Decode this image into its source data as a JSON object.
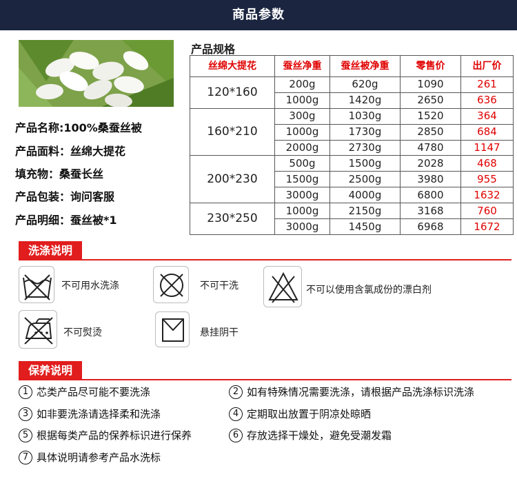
{
  "header": {
    "title": "商品参数"
  },
  "product": {
    "name": "产品名称:100%桑蚕丝被",
    "fabric": "产品面料：丝绵大提花",
    "filling": "填充物：桑蚕长丝",
    "packaging": "产品包装：询问客服",
    "details": "产品明细：蚕丝被*1"
  },
  "spec": {
    "title": "产品规格",
    "headers": [
      "丝绵大提花",
      "蚕丝净重",
      "蚕丝被净重",
      "零售价",
      "出厂价"
    ],
    "sizes": [
      "120*160",
      "160*210",
      "200*230",
      "230*250"
    ],
    "rows": [
      [
        "200g",
        "620g",
        "1090",
        "261"
      ],
      [
        "1000g",
        "1420g",
        "2650",
        "636"
      ],
      [
        "300g",
        "1030g",
        "1520",
        "364"
      ],
      [
        "1000g",
        "1730g",
        "2850",
        "684"
      ],
      [
        "2000g",
        "2730g",
        "4780",
        "1147"
      ],
      [
        "500g",
        "1500g",
        "2028",
        "468"
      ],
      [
        "1500g",
        "2500g",
        "3980",
        "955"
      ],
      [
        "3000g",
        "4000g",
        "6800",
        "1632"
      ],
      [
        "1000g",
        "2150g",
        "3168",
        "760"
      ],
      [
        "3000g",
        "1450g",
        "6968",
        "1672"
      ]
    ]
  },
  "wash": {
    "title": "洗涤说明",
    "items": [
      {
        "icon": "no-water-wash-icon",
        "label": "不可用水洗涤"
      },
      {
        "icon": "no-dry-clean-icon",
        "label": "不可干洗"
      },
      {
        "icon": "no-chlorine-bleach-icon",
        "label": "不可以使用含氯成份的漂白剂"
      },
      {
        "icon": "no-iron-icon",
        "label": "不可熨烫"
      },
      {
        "icon": "hang-dry-shade-icon",
        "label": "悬挂阴干"
      }
    ]
  },
  "care": {
    "title": "保养说明",
    "items": [
      {
        "num": "1",
        "text": "芯类产品尽可能不要洗涤"
      },
      {
        "num": "2",
        "text": "如有特殊情况需要洗涤，请根据产品洗涤标识洗涤"
      },
      {
        "num": "3",
        "text": "如非要洗涤请选择柔和洗涤"
      },
      {
        "num": "4",
        "text": "定期取出放置于阴凉处晾晒"
      },
      {
        "num": "5",
        "text": "根据每类产品的保养标识进行保养"
      },
      {
        "num": "6",
        "text": "存放选择干燥处，避免受潮发霜"
      },
      {
        "num": "7",
        "text": "具体说明请参考产品水洗标"
      }
    ]
  }
}
